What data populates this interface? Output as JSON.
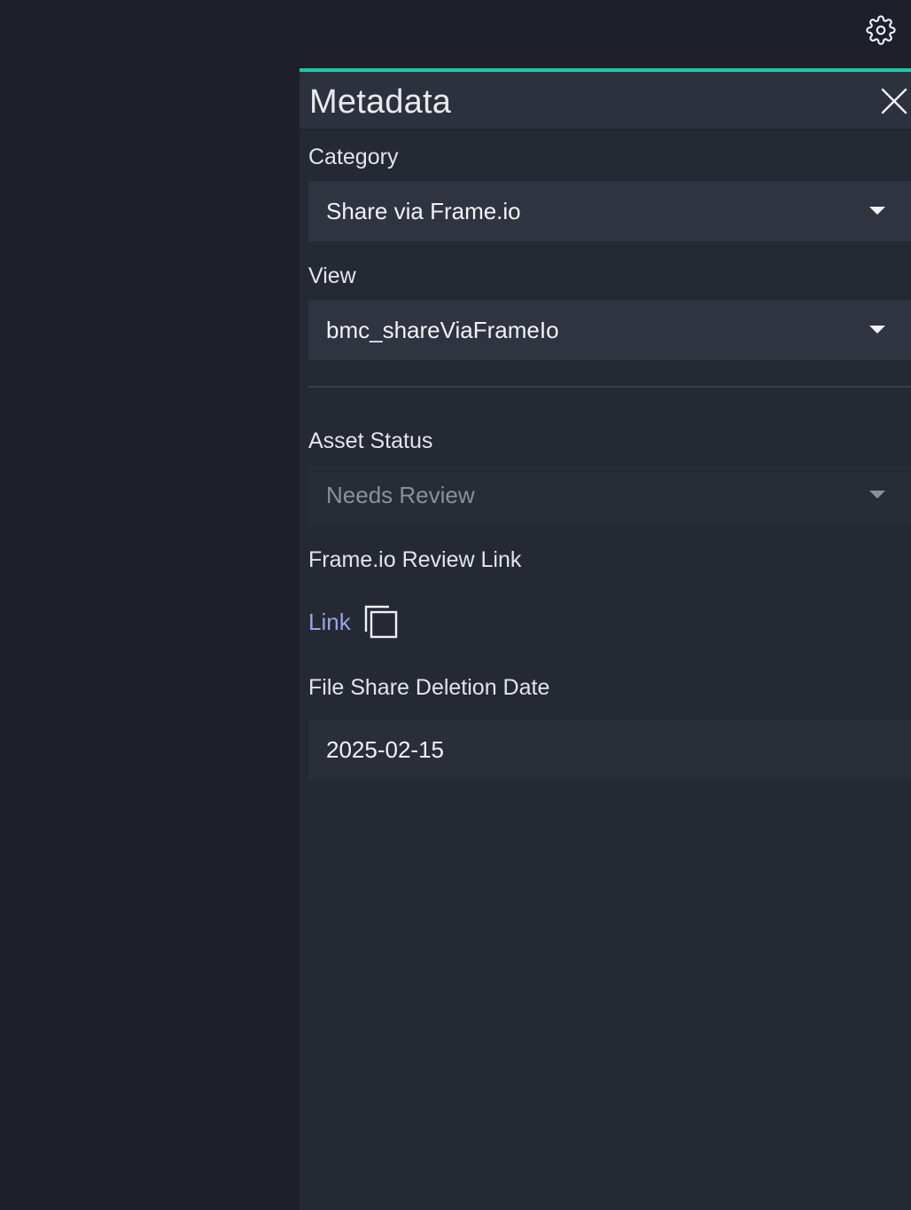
{
  "header": {
    "settings_icon": "gear-icon"
  },
  "panel": {
    "title": "Metadata",
    "close_icon": "close-icon",
    "accent_color": "#1ec9a8"
  },
  "fields": {
    "category": {
      "label": "Category",
      "value": "Share via Frame.io"
    },
    "view": {
      "label": "View",
      "value": "bmc_shareViaFrameIo"
    },
    "asset_status": {
      "label": "Asset Status",
      "value": "Needs Review",
      "disabled": true
    },
    "review_link": {
      "label": "Frame.io Review Link",
      "link_text": "Link",
      "copy_icon": "copy-icon",
      "link_color": "#9aa3e8"
    },
    "deletion_date": {
      "label": "File Share Deletion Date",
      "value": "2025-02-15"
    }
  }
}
